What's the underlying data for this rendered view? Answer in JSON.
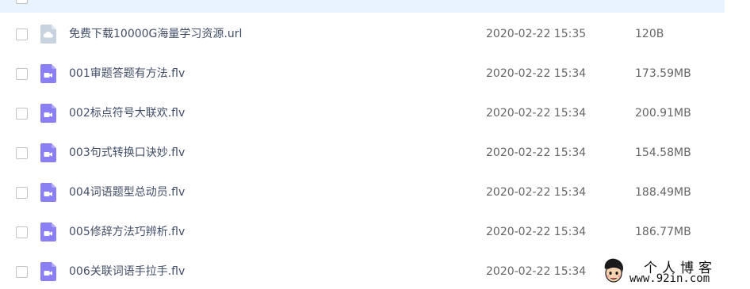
{
  "colors": {
    "selected_row_bg": "#e8f3fd",
    "cloud_icon": "#c9d3e0",
    "video_icon": "#8b7ff4",
    "filename_text": "#424e67",
    "meta_text": "#666666"
  },
  "files": [
    {
      "name": "免费下载10000G海量学习资源.url",
      "date": "2020-02-22 15:35",
      "size": "120B",
      "icon": "cloud-link-icon"
    },
    {
      "name": "001审题答题有方法.flv",
      "date": "2020-02-22 15:34",
      "size": "173.59MB",
      "icon": "video-file-icon"
    },
    {
      "name": "002标点符号大联欢.flv",
      "date": "2020-02-22 15:34",
      "size": "200.91MB",
      "icon": "video-file-icon"
    },
    {
      "name": "003句式转换口诀妙.flv",
      "date": "2020-02-22 15:34",
      "size": "154.58MB",
      "icon": "video-file-icon"
    },
    {
      "name": "004词语题型总动员.flv",
      "date": "2020-02-22 15:34",
      "size": "188.49MB",
      "icon": "video-file-icon"
    },
    {
      "name": "005修辞方法巧辨析.flv",
      "date": "2020-02-22 15:34",
      "size": "186.77MB",
      "icon": "video-file-icon"
    },
    {
      "name": "006关联词语手拉手.flv",
      "date": "2020-02-22 15:34",
      "size": "",
      "icon": "video-file-icon"
    }
  ],
  "watermark": {
    "title": "个人博客",
    "url": "www.92in.com"
  }
}
